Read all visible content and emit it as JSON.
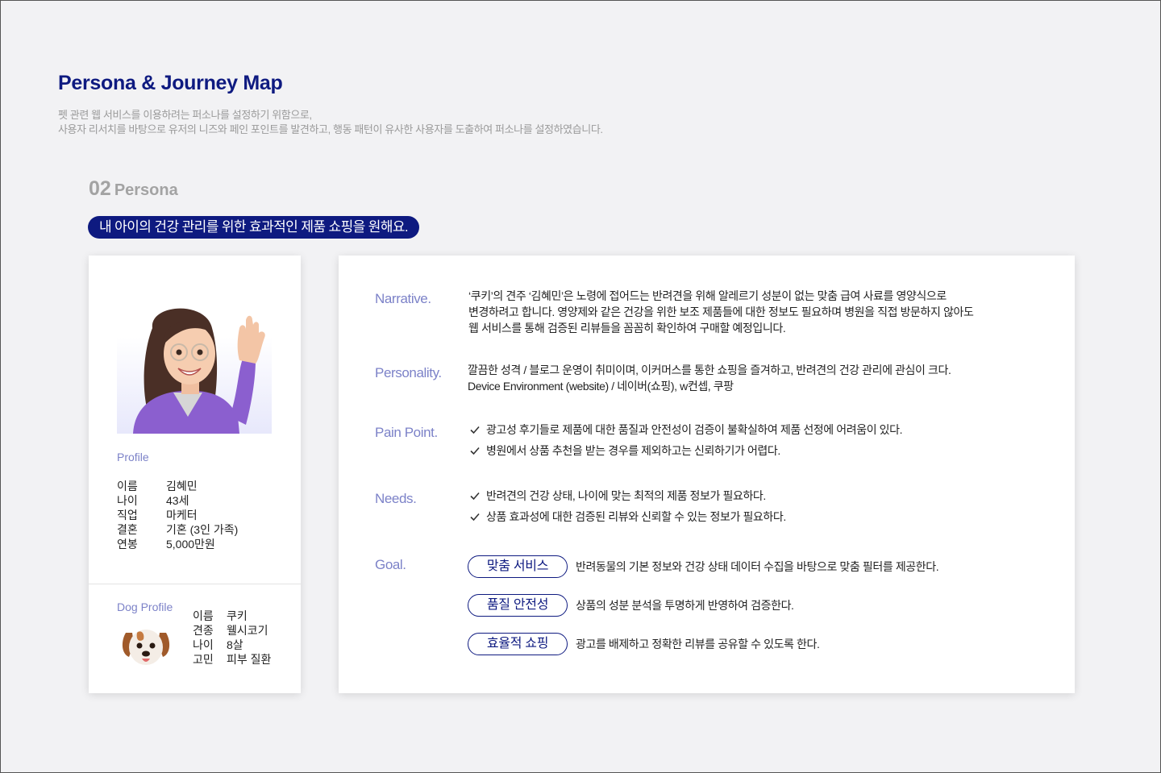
{
  "header": {
    "title": "Persona & Journey Map",
    "intro_line1": "펫 관련 웹 서비스를 이용하려는 퍼소나를 설정하기 위함으로,",
    "intro_line2": "사용자 리서치를 바탕으로 유저의 니즈와 페인 포인트를 발견하고, 행동 패턴이 유사한 사용자를 도출하여 퍼소나를 설정하였습니다."
  },
  "section": {
    "number": "02",
    "name": "Persona"
  },
  "quote": "내 아이의 건강 관리를 위한 효과적인 제품 쇼핑을 원해요.",
  "profile": {
    "heading": "Profile",
    "rows": [
      {
        "key": "이름",
        "value": "김혜민"
      },
      {
        "key": "나이",
        "value": "43세"
      },
      {
        "key": "직업",
        "value": "마케터"
      },
      {
        "key": "결혼",
        "value": "기혼 (3인 가족)"
      },
      {
        "key": "연봉",
        "value": "5,000만원"
      }
    ]
  },
  "dog_profile": {
    "heading": "Dog Profile",
    "rows": [
      {
        "key": "이름",
        "value": "쿠키"
      },
      {
        "key": "견종",
        "value": "웰시코기"
      },
      {
        "key": "나이",
        "value": "8살"
      },
      {
        "key": "고민",
        "value": "피부 질환"
      }
    ]
  },
  "narrative": {
    "label": "Narrative.",
    "lines": [
      "‘쿠키’의 견주 ‘김혜민’은 노령에 접어드는 반려견을 위해 알레르기 성분이 없는 맞춤 급여 사료를 영양식으로",
      "변경하려고 합니다. 영양제와 같은 건강을 위한 보조 제품들에 대한 정보도 필요하며 병원을 직접 방문하지 않아도",
      "웹 서비스를 통해 검증된 리뷰들을 꼼꼼히 확인하여 구매할 예정입니다."
    ]
  },
  "personality": {
    "label": "Personality.",
    "lines": [
      "깔끔한 성격 / 블로그 운영이 취미이며, 이커머스를 통한 쇼핑을 즐겨하고, 반려견의 건강 관리에 관심이 크다.",
      "Device Environment (website) / 네이버(쇼핑), w컨셉, 쿠팡"
    ]
  },
  "pain_point": {
    "label": "Pain Point.",
    "items": [
      "광고성 후기들로 제품에 대한 품질과 안전성이 검증이 불확실하여 제품 선정에 어려움이 있다.",
      "병원에서 상품 추천을 받는 경우를 제외하고는 신뢰하기가 어렵다."
    ]
  },
  "needs": {
    "label": "Needs.",
    "items": [
      "반려견의 건강 상태, 나이에 맞는 최적의 제품 정보가 필요하다.",
      "상품 효과성에 대한 검증된 리뷰와 신뢰할 수 있는 정보가 필요하다."
    ]
  },
  "goal": {
    "label": "Goal.",
    "items": [
      {
        "tag": "맞춤 서비스",
        "text": "반려동물의 기본 정보와 건강 상태 데이터 수집을 바탕으로 맞춤 필터를 제공한다."
      },
      {
        "tag": "품질 안전성",
        "text": "상품의 성분 분석을 투명하게 반영하여 검증한다."
      },
      {
        "tag": "효율적 쇼핑",
        "text": "광고를 배제하고 정확한 리뷰를 공유할 수 있도록 한다."
      }
    ]
  },
  "colors": {
    "brand": "#0e1a80",
    "label": "#7c82c8",
    "muted": "#9a9a9a"
  },
  "icons": {
    "check": "check-icon",
    "avatar": "memoji-woman-waving",
    "dog": "memoji-dog-face"
  }
}
